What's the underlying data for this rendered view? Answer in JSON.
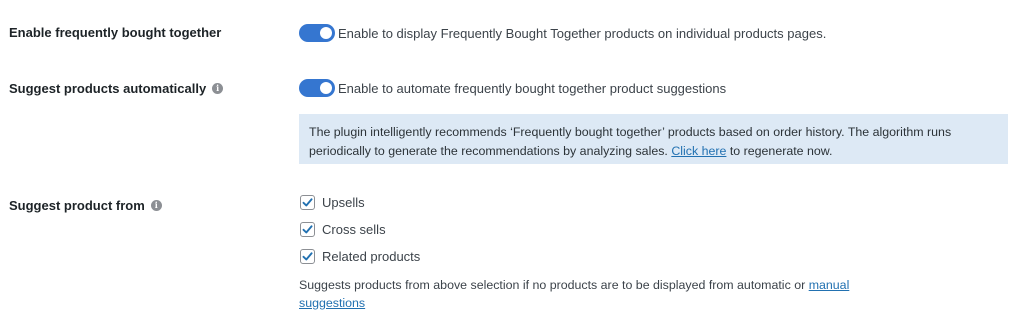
{
  "settings": {
    "fbt": {
      "label": "Enable frequently bought together",
      "toggle_on": true,
      "description": "Enable to display Frequently Bought Together products on individual products pages."
    },
    "auto": {
      "label": "Suggest products automatically",
      "info_icon": "info-icon",
      "toggle_on": true,
      "description": "Enable to automate frequently bought together product suggestions"
    },
    "notice": {
      "text_before": "The plugin intelligently recommends ‘Frequently bought together’ products based on order history. The algorithm runs periodically to generate the recommendations by analyzing sales.",
      "link_text": "Click here",
      "text_after": "to regenerate now."
    },
    "source": {
      "label": "Suggest product from",
      "info_icon": "info-icon",
      "options": [
        {
          "label": "Upsells",
          "checked": true
        },
        {
          "label": "Cross sells",
          "checked": true
        },
        {
          "label": "Related products",
          "checked": true
        }
      ],
      "description_before": "Suggests products from above selection if no products are to be displayed from automatic or",
      "link_text": "manual suggestions"
    }
  },
  "colors": {
    "toggle_on": "#3576d0",
    "notice_bg": "#dde9f5",
    "link": "#2271b1",
    "check": "#2271b1"
  }
}
